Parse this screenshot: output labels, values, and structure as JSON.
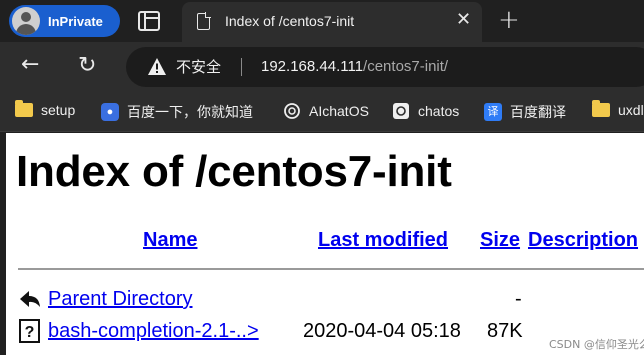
{
  "browser": {
    "profile_label": "InPrivate",
    "tab": {
      "title": "Index of /centos7-init",
      "close_glyph": "✕"
    },
    "new_tab_glyph": "+",
    "security_label": "不安全",
    "url_host": "192.168.44.111",
    "url_path": "/centos7-init/",
    "bookmarks": [
      {
        "label": "setup",
        "icon": "folder-icon"
      },
      {
        "label": "百度一下，你就知道",
        "icon": "baidu-icon"
      },
      {
        "label": "AIchatOS",
        "icon": "openai-icon"
      },
      {
        "label": "chatos",
        "icon": "openai-icon"
      },
      {
        "label": "百度翻译",
        "icon": "translate-icon"
      },
      {
        "label": "uxdl",
        "icon": "folder-icon"
      }
    ],
    "colors": {
      "inprivate": "#1a5fcf",
      "chrome_bg": "#2d2d2d",
      "link": "#0000ee"
    }
  },
  "page": {
    "heading": "Index of /centos7-init",
    "columns": {
      "name": "Name",
      "last_modified": "Last modified",
      "size": "Size",
      "description": "Description"
    },
    "rows": [
      {
        "name": "Parent Directory",
        "modified": "",
        "size": "-",
        "icon": "back-arrow-icon"
      },
      {
        "name": "bash-completion-2.1-..>",
        "modified": "2020-04-04 05:18",
        "size": "87K",
        "icon": "unknown-file-icon"
      }
    ]
  },
  "watermark": "CSDN @信仰圣光么"
}
